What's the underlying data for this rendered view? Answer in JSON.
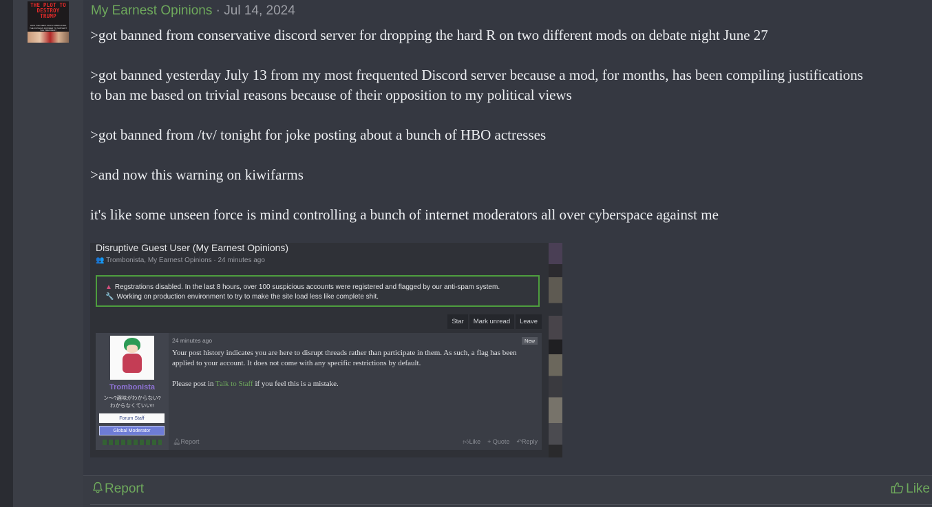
{
  "avatar": {
    "title": "THE PLOT TO DESTROY TRUMP",
    "subtitle": "HOW THE DEEP STATE FABRICATED THE RUSSIAN DOSSIER TO SUBVERT THE PRESIDENT"
  },
  "post": {
    "author": "My Earnest Opinions",
    "separator": "·",
    "date": "Jul 14, 2024",
    "paragraphs": [
      ">got banned from conservative discord server for dropping the hard R on two different mods on debate night June 27",
      ">got banned yesterday July 13 from my most frequented Discord server because a mod, for months, has been compiling justifications to ban me based on trivial reasons because of their opposition to my political views",
      ">got banned from /tv/ tonight for joke posting about a bunch of HBO actresses",
      ">and now this warning on kiwifarms",
      "it's like some unseen force is mind controlling a bunch of internet moderators all over cyberspace against me"
    ]
  },
  "embed": {
    "thread_title": "Disruptive Guest User (My Earnest Opinions)",
    "thread_meta": "Trombonista, My Earnest Opinions · 24 minutes ago",
    "notice_line1": "Regstrations disabled. In the last 8 hours, over 100 suspicious accounts were registered and flagged by our anti-spam system.",
    "notice_line2": "Working on production environment to try to make the site load less like complete shit.",
    "buttons": [
      "Star",
      "Mark unread",
      "Leave"
    ],
    "username": "Trombonista",
    "user_title_1": "ン〜?趣味がわからない?",
    "user_title_2": "わからなくていい!!",
    "badge_staff": "Forum Staff",
    "badge_gmod": "Global Moderator",
    "time": "24 minutes ago",
    "new_label": "New",
    "body_p1": "Your post history indicates you are here to disrupt threads rather than participate in them. As such, a flag has been applied to your account. It does not come with any specific restrictions by default.",
    "body_p2_pre": "Please post in ",
    "body_p2_link": "Talk to Staff",
    "body_p2_post": " if you feel this is a mistake.",
    "footer_report": "Report",
    "footer_like": "Like",
    "footer_quote": "+ Quote",
    "footer_reply": "Reply"
  },
  "footer": {
    "report_label": "Report",
    "like_label": "Like"
  },
  "colors": {
    "accent_green": "#6ea95c",
    "background": "#353841",
    "text": "#eceef1"
  },
  "icons": [
    "bell-icon",
    "thumbs-up-icon"
  ]
}
